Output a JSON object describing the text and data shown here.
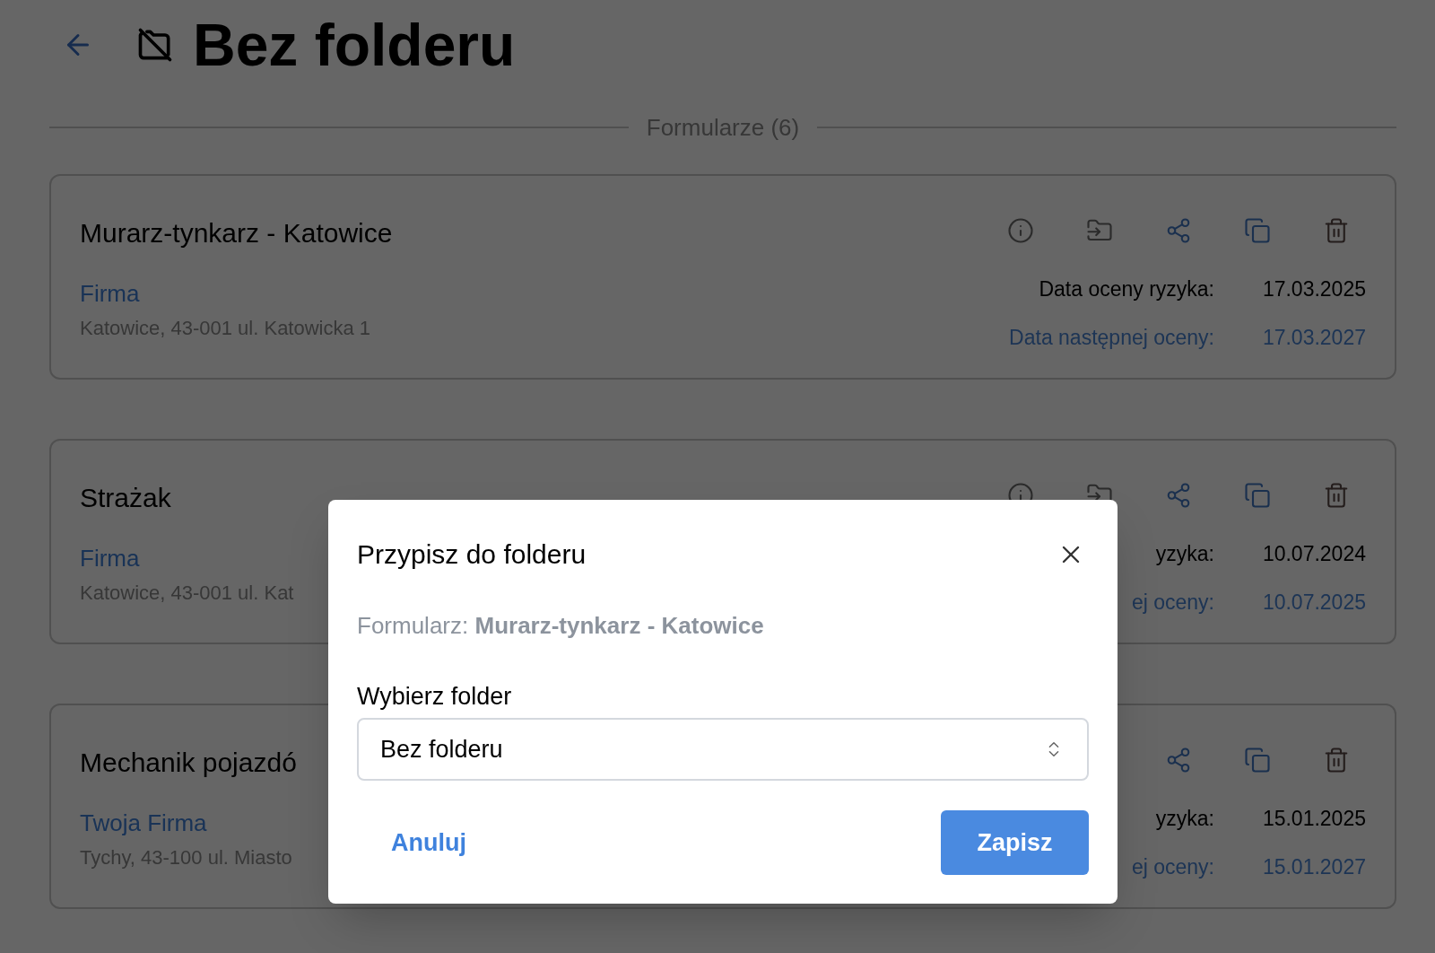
{
  "header": {
    "title": "Bez folderu"
  },
  "section_label": "Formularze (6)",
  "cards": [
    {
      "title": "Murarz-tynkarz - Katowice",
      "company": "Firma",
      "address": "Katowice, 43-001 ul. Katowicka 1",
      "actions": [
        {
          "kind": "info"
        },
        {
          "kind": "move"
        },
        {
          "kind": "share"
        },
        {
          "kind": "copy"
        },
        {
          "kind": "delete"
        }
      ],
      "dates": [
        {
          "kind": "current",
          "label": "Data oceny ryzyka:",
          "value": "17.03.2025"
        },
        {
          "kind": "next",
          "label": "Data następnej oceny:",
          "value": "17.03.2027"
        }
      ]
    },
    {
      "title": "Strażak",
      "company": "Firma",
      "address": "Katowice, 43-001 ul. Kat",
      "actions": [
        {
          "kind": "info"
        },
        {
          "kind": "move"
        },
        {
          "kind": "share"
        },
        {
          "kind": "copy"
        },
        {
          "kind": "delete"
        }
      ],
      "dates": [
        {
          "kind": "current",
          "label": "yzyka:",
          "value": "10.07.2024"
        },
        {
          "kind": "next",
          "label": "ej oceny:",
          "value": "10.07.2025"
        }
      ]
    },
    {
      "title": "Mechanik pojazdó",
      "company": "Twoja Firma",
      "address": "Tychy, 43-100 ul. Miasto",
      "actions": [
        {
          "kind": "share"
        },
        {
          "kind": "copy"
        },
        {
          "kind": "delete"
        }
      ],
      "dates": [
        {
          "kind": "current",
          "label": "yzyka:",
          "value": "15.01.2025"
        },
        {
          "kind": "next",
          "label": "ej oceny:",
          "value": "15.01.2027"
        }
      ]
    }
  ],
  "dialog": {
    "title": "Przypisz do folderu",
    "form_label": "Formularz: **Murarz-tynkarz - Katowice**",
    "select_label": "Wybierz folder",
    "select_value": "Bez folderu",
    "buttons": [
      {
        "kind": "cancel",
        "label": "Anuluj"
      },
      {
        "kind": "primary",
        "label": "Zapisz"
      }
    ]
  }
}
